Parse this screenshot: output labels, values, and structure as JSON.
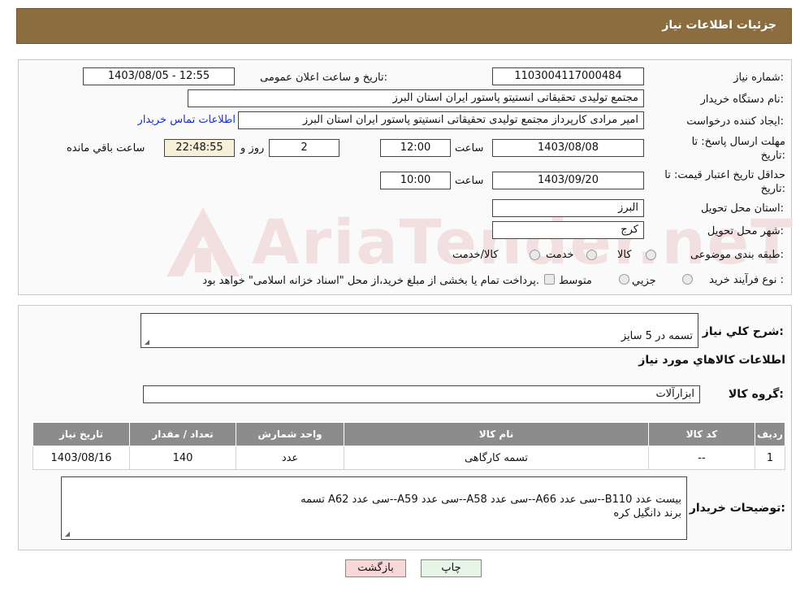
{
  "header": {
    "title": "جزئیات اطلاعات نیاز"
  },
  "watermark": "AriaTender.neT",
  "form": {
    "need_number_label": "شماره نیاز:",
    "need_number": "1103004117000484",
    "announce_label": "تاریخ و ساعت اعلان عمومی:",
    "announce_value": "1403/08/05 - 12:55",
    "buyer_org_label": "نام دستگاه خریدار:",
    "buyer_org": "مجتمع تولیدی تحقیقاتی انستیتو پاستور ایران استان البرز",
    "creator_label": "ایجاد کننده درخواست:",
    "creator": "امیر مرادی کارپرداز مجتمع تولیدی تحقیقاتی انستیتو پاستور ایران استان البرز",
    "contact_link": "اطلاعات تماس خریدار",
    "reply_deadline_label_1": "مهلت ارسال پاسخ: تا",
    "reply_deadline_label_2": "تاریخ:",
    "reply_date": "1403/08/08",
    "time_label": "ساعت",
    "reply_time": "12:00",
    "days_value": "2",
    "days_label": "روز و",
    "remaining_time": "22:48:55",
    "remaining_label": "ساعت باقي مانده",
    "price_validity_label_1": "حداقل تاریخ اعتبار قیمت: تا",
    "price_validity_label_2": "تاریخ:",
    "price_date": "1403/09/20",
    "price_time": "10:00",
    "province_label": "استان محل تحویل:",
    "province": "البرز",
    "city_label": "شهر محل تحویل:",
    "city": "کرج",
    "category_label": "طبقه بندی موضوعی:",
    "category_options": [
      "کالا",
      "خدمت",
      "کالا/خدمت"
    ],
    "purchase_type_label": "نوع فرآیند خرید :",
    "purchase_options": [
      "جزیي",
      "متوسط"
    ],
    "purchase_note": "پرداخت تمام یا بخشی از مبلغ خرید،از محل \"اسناد خزانه اسلامی\" خواهد بود."
  },
  "details": {
    "summary_label": "شرح کلي نياز:",
    "summary": "تسمه در 5 سایز",
    "goods_info_title": "اطلاعات کالاهاي مورد نياز",
    "goods_group_label": "گروه کالا:",
    "goods_group": "ابزارآلات",
    "table": {
      "headers": [
        "ردیف",
        "کد کالا",
        "نام کالا",
        "واحد شمارش",
        "تعداد / مقدار",
        "تاریخ نیاز"
      ],
      "rows": [
        [
          "1",
          "--",
          "تسمه کارگاهی",
          "عدد",
          "140",
          "1403/08/16"
        ]
      ]
    },
    "buyer_notes_label": "توضیحات خریدار:",
    "buyer_notes": "تسمه A62 سی عدد--A59 سی عدد--A58 سی عدد--A66 سی عدد--B110 بیست عدد\nبرند دانگیل کره"
  },
  "buttons": {
    "print": "چاپ",
    "back": "بازگشت"
  },
  "colors": {
    "header_bg": "#8c6d3f",
    "table_header_bg": "#8c8c8c",
    "back_button_bg": "#f8d7d7",
    "print_button_bg": "#e6f5e6",
    "link": "#1a2fd0"
  }
}
